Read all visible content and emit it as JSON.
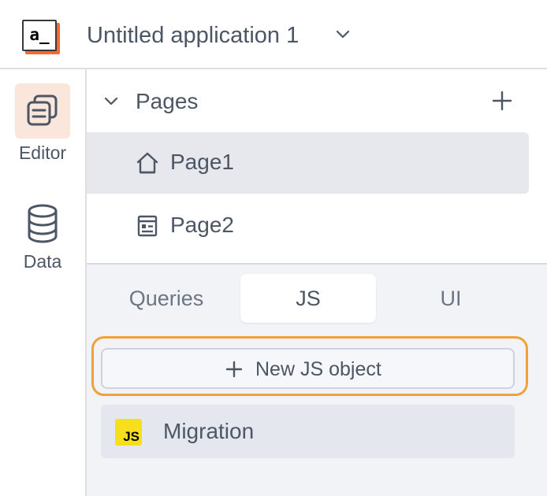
{
  "header": {
    "logo_text": "a_",
    "app_title": "Untitled application 1"
  },
  "rail": {
    "items": [
      {
        "label": "Editor",
        "icon": "editor-icon",
        "active": true
      },
      {
        "label": "Data",
        "icon": "database-icon",
        "active": false
      }
    ]
  },
  "pages": {
    "title": "Pages",
    "items": [
      {
        "label": "Page1",
        "icon": "home-icon",
        "selected": true
      },
      {
        "label": "Page2",
        "icon": "page-icon",
        "selected": false
      }
    ]
  },
  "tabs": {
    "items": [
      {
        "label": "Queries",
        "active": false
      },
      {
        "label": "JS",
        "active": true
      },
      {
        "label": "UI",
        "active": false
      }
    ]
  },
  "new_js_button": {
    "label": "New JS object"
  },
  "js_objects": {
    "items": [
      {
        "label": "Migration",
        "badge": "JS"
      }
    ]
  },
  "colors": {
    "accent": "#f86a2b",
    "highlight": "#f0a13c",
    "selected_bg": "#e6e8ee",
    "rail_active_bg": "#fbe6dc",
    "js_yellow": "#f7df1e"
  }
}
